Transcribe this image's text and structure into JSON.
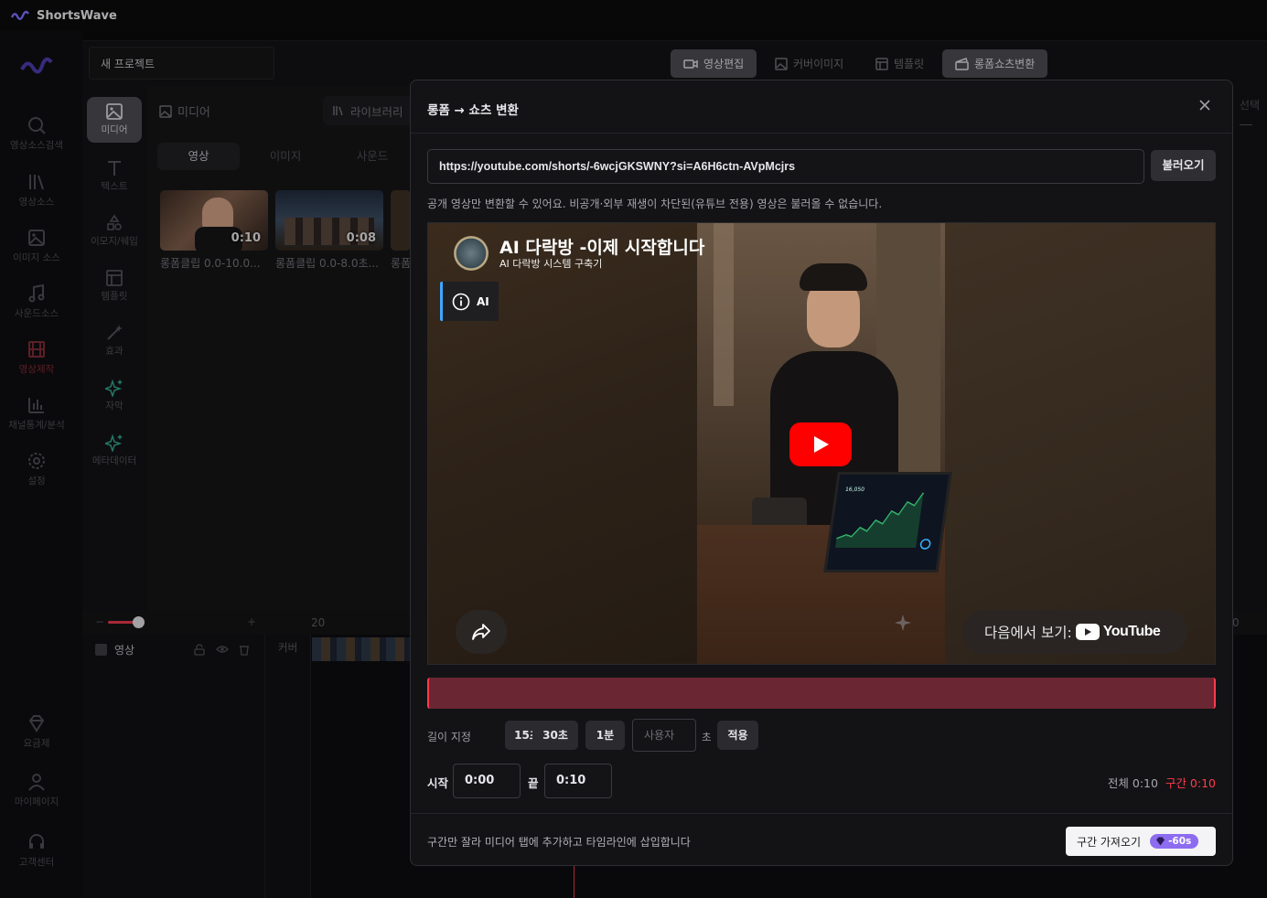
{
  "app": {
    "name": "ShortsWave"
  },
  "nav": {
    "items": [
      {
        "label": "영상소스검색",
        "icon": "search-icon"
      },
      {
        "label": "영상소스",
        "icon": "library-icon"
      },
      {
        "label": "이미지 소스",
        "icon": "image-icon"
      },
      {
        "label": "사운드소스",
        "icon": "music-icon"
      },
      {
        "label": "영상제작",
        "icon": "film-icon"
      },
      {
        "label": "채널통계/분석",
        "icon": "bar-chart-icon"
      },
      {
        "label": "설정",
        "icon": "gear-icon"
      },
      {
        "label": "요금제",
        "icon": "diamond-icon"
      },
      {
        "label": "마이페이지",
        "icon": "user-icon"
      },
      {
        "label": "고객센터",
        "icon": "headset-icon"
      }
    ]
  },
  "project": {
    "name": "새 프로젝트"
  },
  "top_tabs": [
    {
      "label": "영상편집",
      "icon": "video-icon"
    },
    {
      "label": "커버이미지",
      "icon": "image-icon"
    },
    {
      "label": "템플릿",
      "icon": "template-icon"
    },
    {
      "label": "롱폼쇼츠변환",
      "icon": "clapper-icon"
    }
  ],
  "tools": [
    {
      "label": "미디어",
      "icon": "image-icon"
    },
    {
      "label": "텍스트",
      "icon": "text-icon"
    },
    {
      "label": "이모지/쉐입",
      "icon": "shapes-icon"
    },
    {
      "label": "템플릿",
      "icon": "template-icon"
    },
    {
      "label": "효과",
      "icon": "magic-wand-icon"
    },
    {
      "label": "자막",
      "icon": "sparkle-icon"
    },
    {
      "label": "메타데이터",
      "icon": "sparkle-icon"
    }
  ],
  "media": {
    "header": "미디어",
    "library": "라이브러리",
    "tabs": [
      "영상",
      "이미지",
      "사운드"
    ],
    "clips": [
      {
        "duration": "0:10",
        "label": "롱폼클립 0.0-10.0..."
      },
      {
        "duration": "0:08",
        "label": "롱폼클립 0.0-8.0초..."
      },
      {
        "duration": "",
        "label": "롱폼"
      }
    ]
  },
  "timeline": {
    "tick": "20",
    "track": "영상",
    "cover": "커버",
    "right_tick": "0"
  },
  "right_panel": {
    "label": "선택"
  },
  "modal": {
    "title": "롱폼 → 쇼츠 변환",
    "url": "https://youtube.com/shorts/-6wcjGKSWNY?si=A6H6ctn-AVpMcjrs",
    "load_label": "불러오기",
    "hint": "공개 영상만 변환할 수 있어요. 비공개·외부 재생이 차단된(유튜브 전용) 영상은 불러올 수 없습니다.",
    "video": {
      "title": "AI 다락방 -이제 시작합니다",
      "channel": "AI 다락방 시스템 구축기",
      "info_label": "AI",
      "watch_on": "다음에서 보기:",
      "youtube": "YouTube",
      "laptop_value": "16,050"
    },
    "length_label": "길이 지정",
    "presets": [
      "15초",
      "30초",
      "1분"
    ],
    "custom_placeholder": "사용자",
    "sec_unit": "초",
    "apply_label": "적용",
    "start_label": "시작",
    "start_value": "0:00",
    "end_label": "끝",
    "end_value": "0:10",
    "total_label": "전체 0:10",
    "segment_label": "구간 0:10",
    "footer_text": "구간만 잘라 미디어 탭에 추가하고 타임라인에 삽입합니다",
    "import_label": "구간 가져오기",
    "credit": "-60s",
    "colors": {
      "accent": "#ff3b4b",
      "range": "#6b2634",
      "credit": "#8e6cf0"
    }
  }
}
